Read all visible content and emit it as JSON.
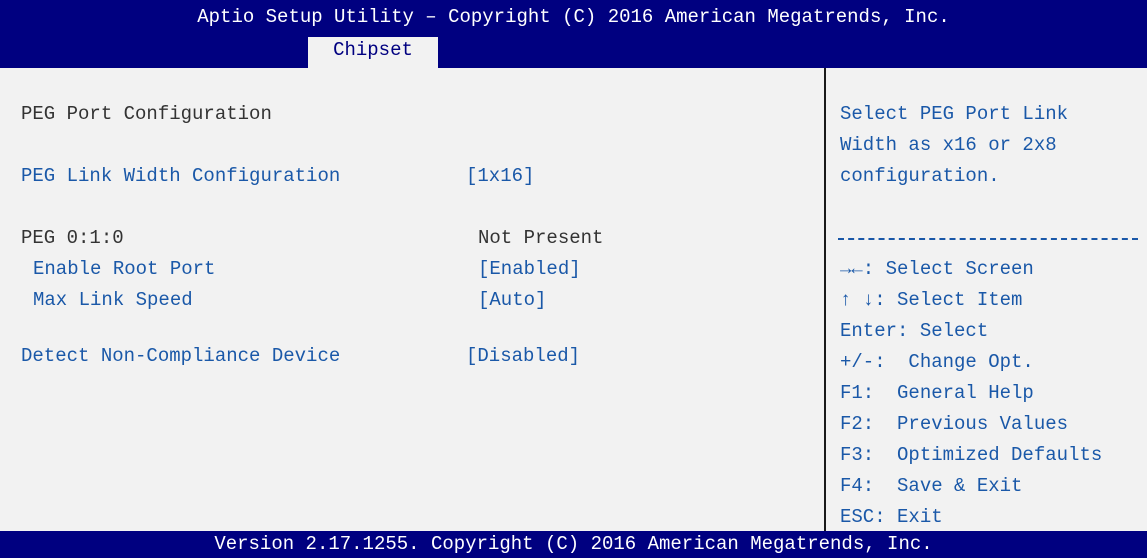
{
  "header": {
    "title": "Aptio Setup Utility – Copyright (C) 2016 American Megatrends, Inc.",
    "active_tab": "Chipset"
  },
  "main": {
    "section_title": "PEG Port Configuration",
    "items": [
      {
        "label": "PEG Link Width Configuration",
        "value": "[1x16]"
      },
      {
        "label": "PEG 0:1:0",
        "value": "Not Present"
      },
      {
        "label": "Enable Root Port",
        "value": "[Enabled]"
      },
      {
        "label": "Max Link Speed",
        "value": "[Auto]"
      },
      {
        "label": "Detect Non-Compliance Device",
        "value": "[Disabled]"
      }
    ]
  },
  "help": {
    "description": [
      "Select PEG Port Link",
      "Width as x16 or 2x8",
      "configuration."
    ],
    "keys": [
      "→←: Select Screen",
      "↑ ↓: Select Item",
      "Enter: Select",
      "+/-:  Change Opt.",
      "F1:  General Help",
      "F2:  Previous Values",
      "F3:  Optimized Defaults",
      "F4:  Save & Exit",
      "ESC: Exit"
    ]
  },
  "footer": {
    "version": "Version 2.17.1255. Copyright (C) 2016 American Megatrends, Inc."
  },
  "colors": {
    "bar": "#000080",
    "panel": "#f2f2f2",
    "selectable_text": "#1a58a8",
    "static_text": "#333333"
  }
}
